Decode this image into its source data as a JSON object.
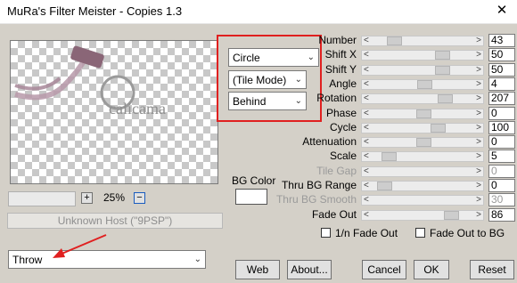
{
  "window": {
    "title": "MuRa's Filter Meister - Copies 1.3",
    "close_glyph": "✕"
  },
  "preview": {
    "watermark": "calicama"
  },
  "zoom": {
    "plus": "+",
    "value": "25%",
    "minus": "−"
  },
  "host_status": "Unknown Host (\"9PSP\")",
  "combos": {
    "shape": "Circle",
    "tile_mode": "(Tile Mode)",
    "placement": "Behind",
    "blend": "Throw"
  },
  "bg_color": {
    "label": "BG Color",
    "value": "#ffffff"
  },
  "accent": {
    "highlight_box": "#e02020",
    "arrow": "#e02020"
  },
  "sliders": [
    {
      "label": "Number",
      "value": "43",
      "level": 0.17,
      "disabled": false
    },
    {
      "label": "Shift X",
      "value": "50",
      "level": 0.72,
      "disabled": false
    },
    {
      "label": "Shift Y",
      "value": "50",
      "level": 0.72,
      "disabled": false
    },
    {
      "label": "Angle",
      "value": "4",
      "level": 0.52,
      "disabled": false
    },
    {
      "label": "Rotation",
      "value": "207",
      "level": 0.75,
      "disabled": false
    },
    {
      "label": "Phase",
      "value": "0",
      "level": 0.5,
      "disabled": false
    },
    {
      "label": "Cycle",
      "value": "100",
      "level": 0.67,
      "disabled": false
    },
    {
      "label": "Attenuation",
      "value": "0",
      "level": 0.5,
      "disabled": false
    },
    {
      "label": "Scale",
      "value": "5",
      "level": 0.1,
      "disabled": false
    },
    {
      "label": "Tile Gap",
      "value": "0",
      "level": 0.0,
      "disabled": true
    },
    {
      "label": "Thru BG Range",
      "value": "0",
      "level": 0.05,
      "disabled": false
    },
    {
      "label": "Thru BG Smooth",
      "value": "30",
      "level": 0.0,
      "disabled": true
    },
    {
      "label": "Fade Out",
      "value": "86",
      "level": 0.82,
      "disabled": false
    }
  ],
  "checkboxes": {
    "inverse_fade": "1/n Fade Out",
    "fade_to_bg": "Fade Out to BG"
  },
  "buttons": {
    "web": "Web",
    "about": "About...",
    "cancel": "Cancel",
    "ok": "OK",
    "reset": "Reset"
  }
}
